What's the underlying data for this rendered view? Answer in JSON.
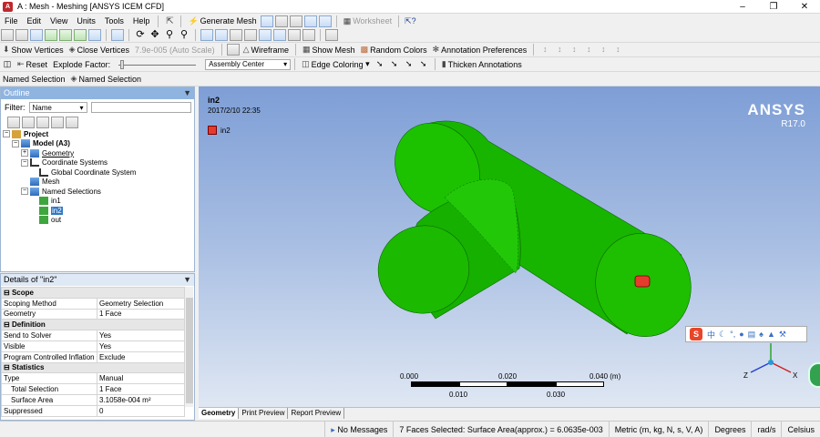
{
  "window": {
    "title": "A : Mesh - Meshing [ANSYS ICEM CFD]",
    "app_icon": "A"
  },
  "menu": [
    "File",
    "Edit",
    "View",
    "Units",
    "Tools",
    "Help"
  ],
  "toolbar1": {
    "generate_mesh": "Generate Mesh",
    "worksheet": "Worksheet"
  },
  "toolbar2": {
    "show_vertices": "Show Vertices",
    "close_vertices": "Close Vertices",
    "auto_scale": "7.9e-005 (Auto Scale)",
    "wireframe": "Wireframe",
    "show_mesh": "Show Mesh",
    "random_colors": "Random Colors",
    "annotation_preferences": "Annotation Preferences"
  },
  "toolbar3": {
    "reset": "Reset",
    "explode_factor": "Explode Factor:",
    "assembly_center": "Assembly Center",
    "edge_coloring": "Edge Coloring",
    "thicken_annotations": "Thicken Annotations"
  },
  "named_sel_bar": {
    "label1": "Named Selection",
    "label2": "Named Selection"
  },
  "outline": {
    "title": "Outline",
    "filter_label": "Filter:",
    "filter_value": "Name",
    "tree": [
      {
        "label": "Project",
        "level": 0
      },
      {
        "label": "Model (A3)",
        "level": 1
      },
      {
        "label": "Geometry",
        "level": 2
      },
      {
        "label": "Coordinate Systems",
        "level": 2
      },
      {
        "label": "Global Coordinate System",
        "level": 3
      },
      {
        "label": "Mesh",
        "level": 2
      },
      {
        "label": "Named Selections",
        "level": 2
      },
      {
        "label": "in1",
        "level": 3
      },
      {
        "label": "in2",
        "level": 3
      },
      {
        "label": "out",
        "level": 3
      }
    ]
  },
  "details": {
    "title": "Details of \"in2\"",
    "rows": [
      {
        "group": "Scope"
      },
      {
        "k": "Scoping Method",
        "v": "Geometry Selection"
      },
      {
        "k": "Geometry",
        "v": "1 Face"
      },
      {
        "group": "Definition"
      },
      {
        "k": "Send to Solver",
        "v": "Yes"
      },
      {
        "k": "Visible",
        "v": "Yes"
      },
      {
        "k": "Program Controlled Inflation",
        "v": "Exclude"
      },
      {
        "group": "Statistics"
      },
      {
        "k": "Type",
        "v": "Manual"
      },
      {
        "k": "Total Selection",
        "v": "1 Face"
      },
      {
        "k": "Surface Area",
        "v": "3.1058e-004 m²"
      },
      {
        "k": "Suppressed",
        "v": "0"
      }
    ]
  },
  "viewport": {
    "name": "in2",
    "date": "2017/2/10 22:35",
    "legend_label": "in2",
    "brand": "ANSYS",
    "version": "R17.0",
    "scale_top": [
      "0.000",
      "0.020",
      "0.040 (m)"
    ],
    "scale_bottom": [
      "0.010",
      "0.030"
    ],
    "axes": [
      "X",
      "Y",
      "Z"
    ]
  },
  "bottom_tabs": [
    "Geometry",
    "Print Preview",
    "Report Preview"
  ],
  "status": {
    "messages": "No Messages",
    "selection": "7 Faces Selected: Surface Area(approx.) = 6.0635e-003",
    "units": "Metric (m, kg, N, s, V, A)",
    "angle": "Degrees",
    "rate": "rad/s",
    "temp": "Celsius"
  },
  "ime": {
    "logo": "S",
    "lang": "中"
  },
  "colors": {
    "geometry": "#1fb200",
    "selected_face": "#e53b2d",
    "panel_title": "#8fb4e0"
  }
}
